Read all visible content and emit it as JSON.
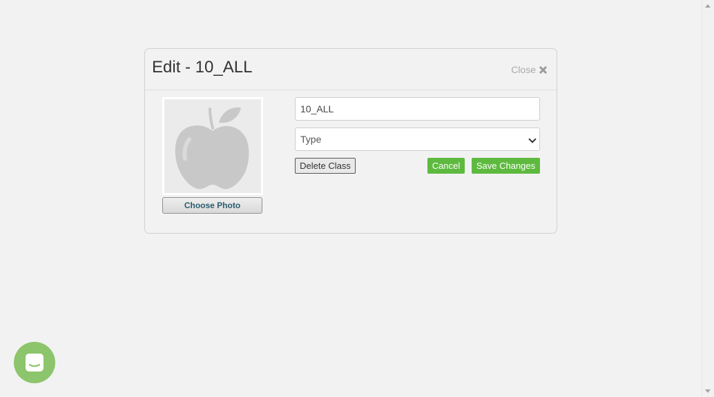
{
  "modal": {
    "title": "Edit - 10_ALL",
    "close_label": "Close",
    "choose_photo_label": "Choose Photo",
    "name_value": "10_ALL",
    "type_placeholder": "Type",
    "delete_label": "Delete Class",
    "cancel_label": "Cancel",
    "save_label": "Save Changes"
  },
  "icons": {
    "close": "close-icon",
    "photo_placeholder": "apple-icon",
    "select_arrow": "chevron-down-icon",
    "chat": "chat-icon"
  },
  "colors": {
    "accent_green": "#5eba3f",
    "chat_green": "#8cc56b",
    "background": "#f2f2f2"
  }
}
